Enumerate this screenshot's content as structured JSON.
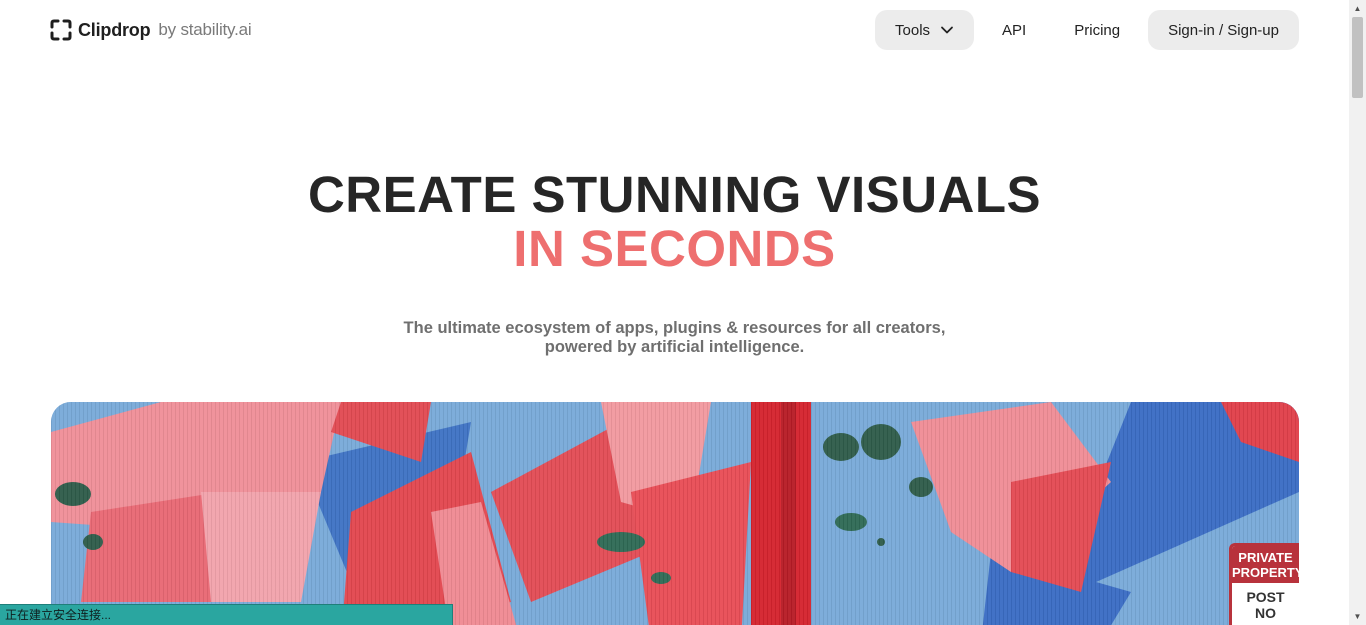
{
  "header": {
    "logo_name": "Clipdrop",
    "logo_by": "by stability.ai",
    "nav": {
      "tools_label": "Tools",
      "api_label": "API",
      "pricing_label": "Pricing",
      "signin_label": "Sign-in / Sign-up"
    }
  },
  "hero": {
    "title_line1": "CREATE STUNNING VISUALS",
    "title_line2": "IN SECONDS",
    "subtitle_line1": "The ultimate ecosystem of apps, plugins & resources for all creators,",
    "subtitle_line2": "powered by artificial intelligence."
  },
  "mural": {
    "sign_top_line1": "PRIVATE",
    "sign_top_line2": "PROPERTY",
    "sign_bottom_line1": "POST",
    "sign_bottom_line2": "NO"
  },
  "status_bar": {
    "text": "正在建立安全连接..."
  },
  "colors": {
    "accent": "#ee6f6f",
    "title": "#262626",
    "button_bg": "#ececec",
    "status_bg": "#2aa6a0"
  },
  "icons": {
    "logo": "clipdrop-frame-icon",
    "tools_chevron": "chevron-down-icon"
  }
}
